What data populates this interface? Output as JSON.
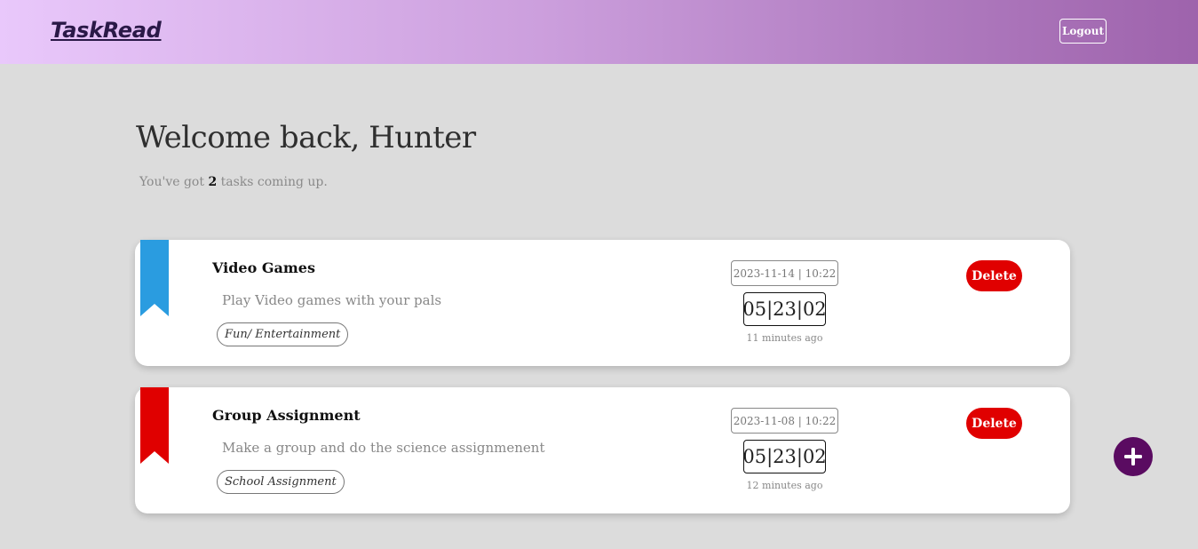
{
  "header": {
    "brand": "TaskRead",
    "logout_label": "Logout",
    "gradient_start": "#e9c8fb",
    "gradient_end": "#9e63ac"
  },
  "welcome": {
    "title": "Welcome back, Hunter",
    "summary_prefix": "You've got",
    "task_count": "2",
    "summary_suffix": "tasks coming up."
  },
  "tasks": [
    {
      "title": "Video Games",
      "description": "Play Video games with your pals",
      "tag": "Fun/ Entertainment",
      "datetime": "2023-11-14 | 10:22",
      "countdown": "05|23|02",
      "created": "11 minutes ago",
      "delete_label": "Delete",
      "ribbon_color": "#2a9ce0"
    },
    {
      "title": "Group Assignment",
      "description": "Make a group and do the science assignmenent",
      "tag": "School Assignment",
      "datetime": "2023-11-08 | 10:22",
      "countdown": "05|23|02",
      "created": "12 minutes ago",
      "delete_label": "Delete",
      "ribbon_color": "#e00000"
    }
  ],
  "fab": {
    "icon": "plus-icon",
    "color": "#5a0b61"
  }
}
